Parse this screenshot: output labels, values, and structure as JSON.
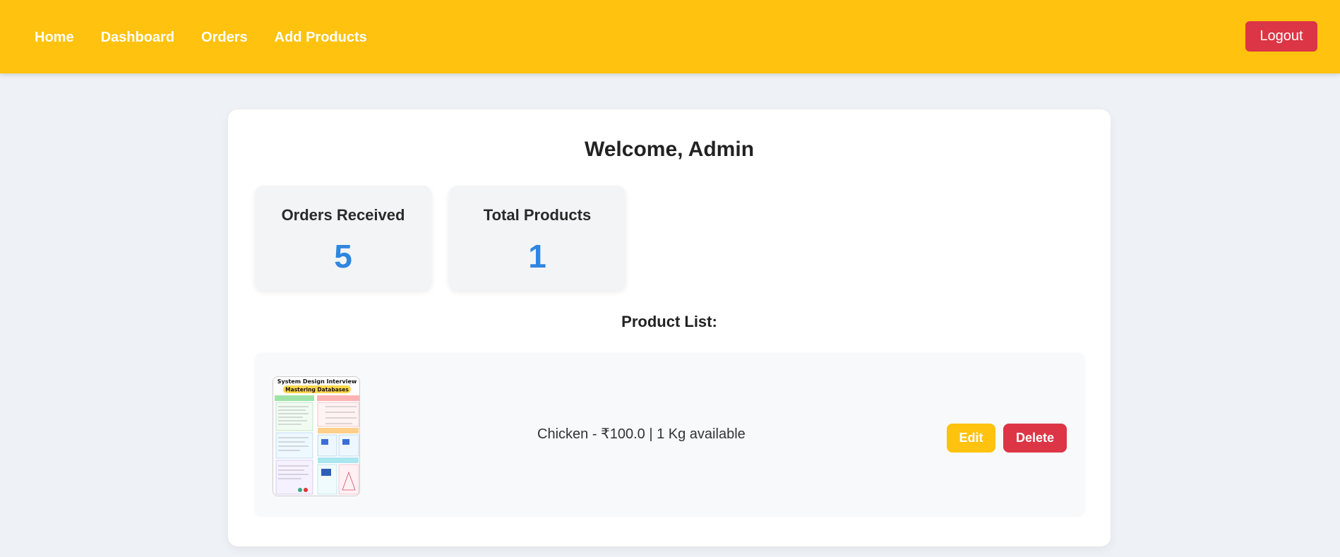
{
  "nav": {
    "links": [
      "Home",
      "Dashboard",
      "Orders",
      "Add Products"
    ],
    "logout_label": "Logout"
  },
  "dashboard": {
    "welcome": "Welcome, Admin",
    "stats": [
      {
        "title": "Orders Received",
        "value": "5"
      },
      {
        "title": "Total Products",
        "value": "1"
      }
    ],
    "product_list_heading": "Product List:"
  },
  "products": [
    {
      "info": "Chicken - ₹100.0 | 1 Kg available",
      "image_title": "System Design Interview",
      "image_subtitle": "Mastering Databases",
      "edit_label": "Edit",
      "delete_label": "Delete"
    }
  ],
  "colors": {
    "navbar": "#ffc20e",
    "danger": "#dc3545",
    "accent_number": "#2f86e0",
    "background": "#eef1f5"
  }
}
